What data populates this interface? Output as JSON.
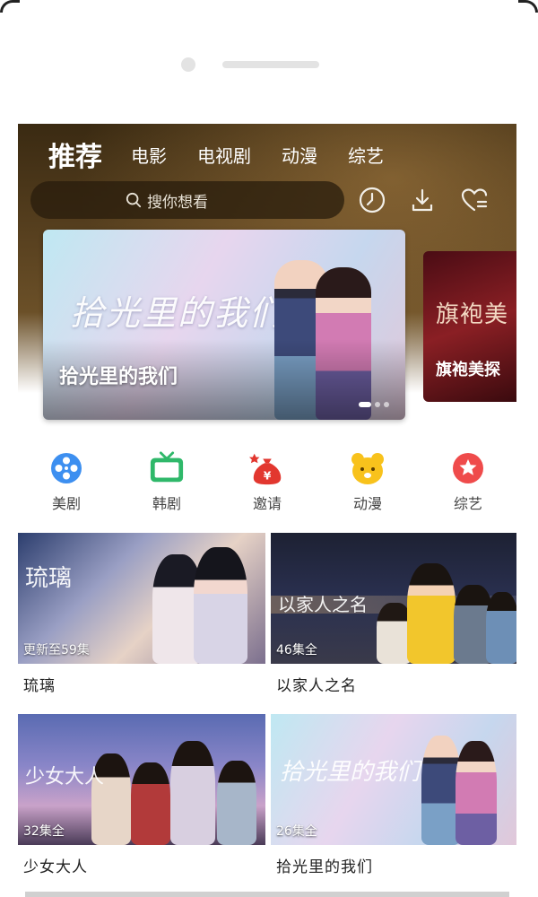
{
  "tabs": [
    {
      "label": "推荐",
      "active": true
    },
    {
      "label": "电影",
      "active": false
    },
    {
      "label": "电视剧",
      "active": false
    },
    {
      "label": "动漫",
      "active": false
    },
    {
      "label": "综艺",
      "active": false
    }
  ],
  "search": {
    "placeholder": "搜你想看"
  },
  "header_icons": [
    "history-icon",
    "download-icon",
    "favorites-icon"
  ],
  "banners": [
    {
      "title": "拾光里的我们",
      "logo": "拾光里的我们"
    },
    {
      "title": "旗袍美探",
      "logo": "旗袍美"
    }
  ],
  "categories": [
    {
      "label": "美剧",
      "icon": "film-reel-icon",
      "color": "#3d8ff0"
    },
    {
      "label": "韩剧",
      "icon": "tv-icon",
      "color": "#2fb86a"
    },
    {
      "label": "邀请",
      "icon": "money-bag-icon",
      "color": "#e2372f"
    },
    {
      "label": "动漫",
      "icon": "bear-icon",
      "color": "#f8c21c"
    },
    {
      "label": "综艺",
      "icon": "star-badge-icon",
      "color": "#ef4b4b"
    }
  ],
  "videos": [
    {
      "title": "琉璃",
      "episodes": "更新至59集",
      "poster_text": "琉璃"
    },
    {
      "title": "以家人之名",
      "episodes": "46集全",
      "poster_text": "以家人之名"
    },
    {
      "title": "少女大人",
      "episodes": "32集全",
      "poster_text": "少女大人"
    },
    {
      "title": "拾光里的我们",
      "episodes": "26集全",
      "poster_text": "拾光里的我们"
    }
  ]
}
